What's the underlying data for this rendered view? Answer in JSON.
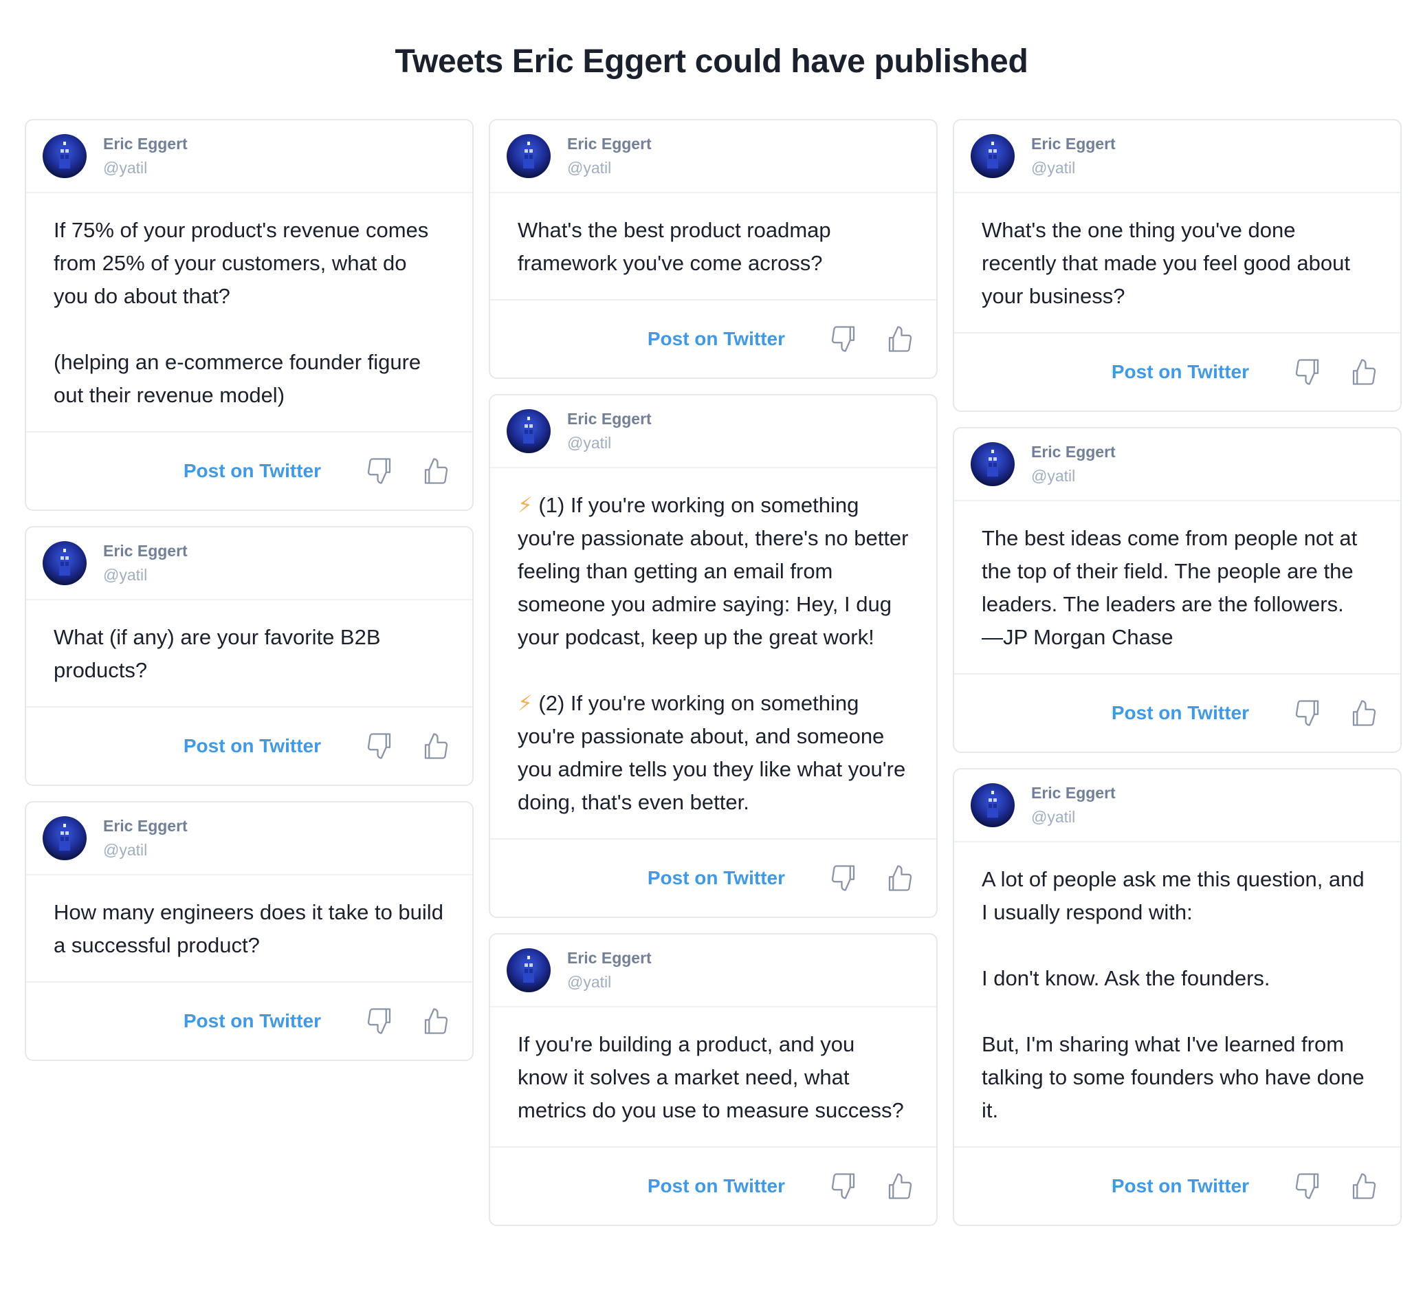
{
  "page": {
    "title": "Tweets Eric Eggert could have published"
  },
  "colors": {
    "accent": "#4299e1",
    "name": "#718096",
    "handle": "#a0aec0",
    "border": "#e5e8ec",
    "bolt": "#f6ad55"
  },
  "icons": {
    "avatar": "tardis-avatar",
    "dislike": "thumbs-down-icon",
    "like": "thumbs-up-icon",
    "bolt": "lightning-icon"
  },
  "author": {
    "name": "Eric Eggert",
    "handle": "@yatil"
  },
  "actions": {
    "post_label": "Post on Twitter"
  },
  "columns": [
    {
      "cards": [
        {
          "text": "If 75% of your product's revenue comes from 25% of your customers, what do you do about that?\n\n(helping an e-commerce founder figure out their revenue model)"
        },
        {
          "text": "What (if any) are your favorite B2B products?"
        },
        {
          "text": "How many engineers does it take to build a successful product?"
        }
      ]
    },
    {
      "cards": [
        {
          "text": "What's the best product roadmap framework you've come across?"
        },
        {
          "bolt": "⚡",
          "text": " (1) If you're working on something you're passionate about, there's no better feeling than getting an email from someone you admire saying: Hey, I dug your podcast, keep up the great work!",
          "bolt2": "⚡",
          "text2": " (2) If you're working on something you're passionate about, and someone you admire tells you they like what you're doing, that's even better."
        },
        {
          "text": "If you're building a product, and you know it solves a market need, what metrics do you use to measure success?"
        }
      ]
    },
    {
      "cards": [
        {
          "text": "What's the one thing you've done recently that made you feel good about your business?"
        },
        {
          "text": "The best ideas come from people not at the top of their field. The people are the leaders. The leaders are the followers.\n—JP Morgan Chase"
        },
        {
          "text": "A lot of people ask me this question, and I usually respond with:\n\nI don't know. Ask the founders.\n\nBut, I'm sharing what I've learned from talking to some founders who have done it."
        }
      ]
    }
  ]
}
